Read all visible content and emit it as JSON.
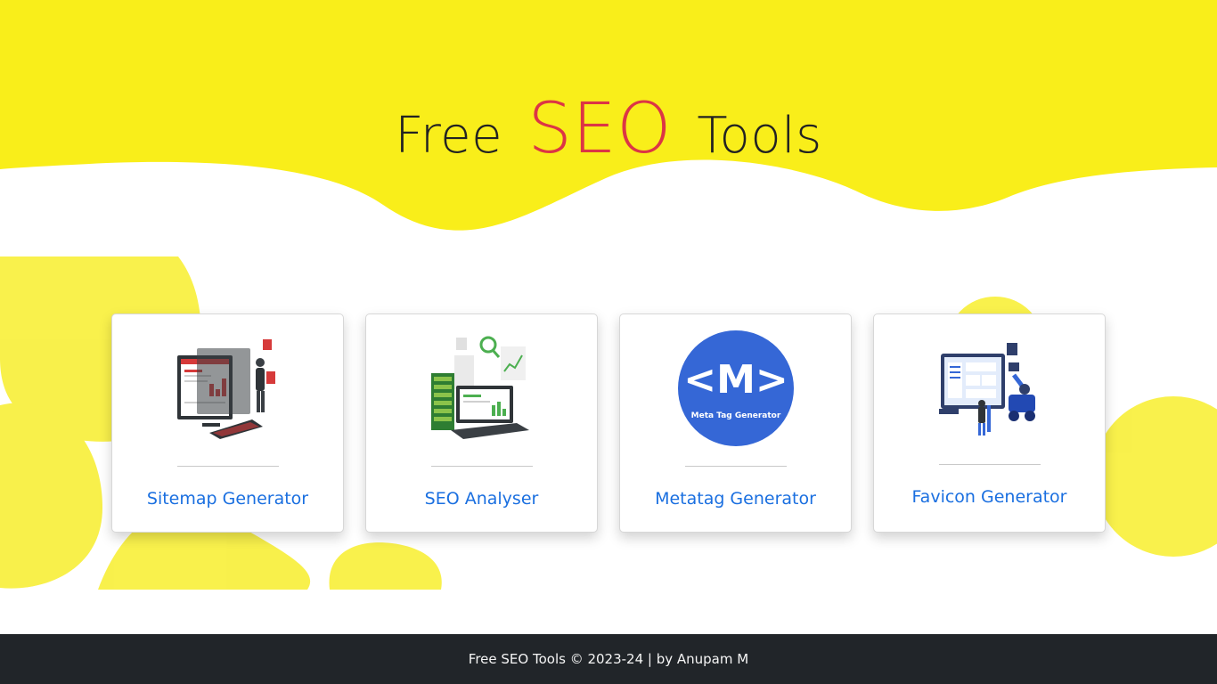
{
  "hero": {
    "title_prefix": "Free",
    "title_accent": "SEO",
    "title_suffix": "Tools"
  },
  "colors": {
    "wave_yellow": "#f9ee1a",
    "blob_yellow": "#f8ef38",
    "accent_red": "#dc3545",
    "link_blue": "#1a6fe0",
    "footer_bg": "#212529"
  },
  "tools": [
    {
      "title": "Sitemap Generator",
      "icon": "sitemap-illustration"
    },
    {
      "title": "SEO Analyser",
      "icon": "seo-analyser-illustration"
    },
    {
      "title": "Metatag Generator",
      "icon": "meta-tag-generator-logo",
      "logo_letter": "<M>",
      "logo_caption": "Meta Tag Generator"
    },
    {
      "title": "Favicon Generator",
      "icon": "favicon-illustration"
    }
  ],
  "footer": {
    "text": "Free SEO Tools © 2023-24 | by Anupam M"
  }
}
